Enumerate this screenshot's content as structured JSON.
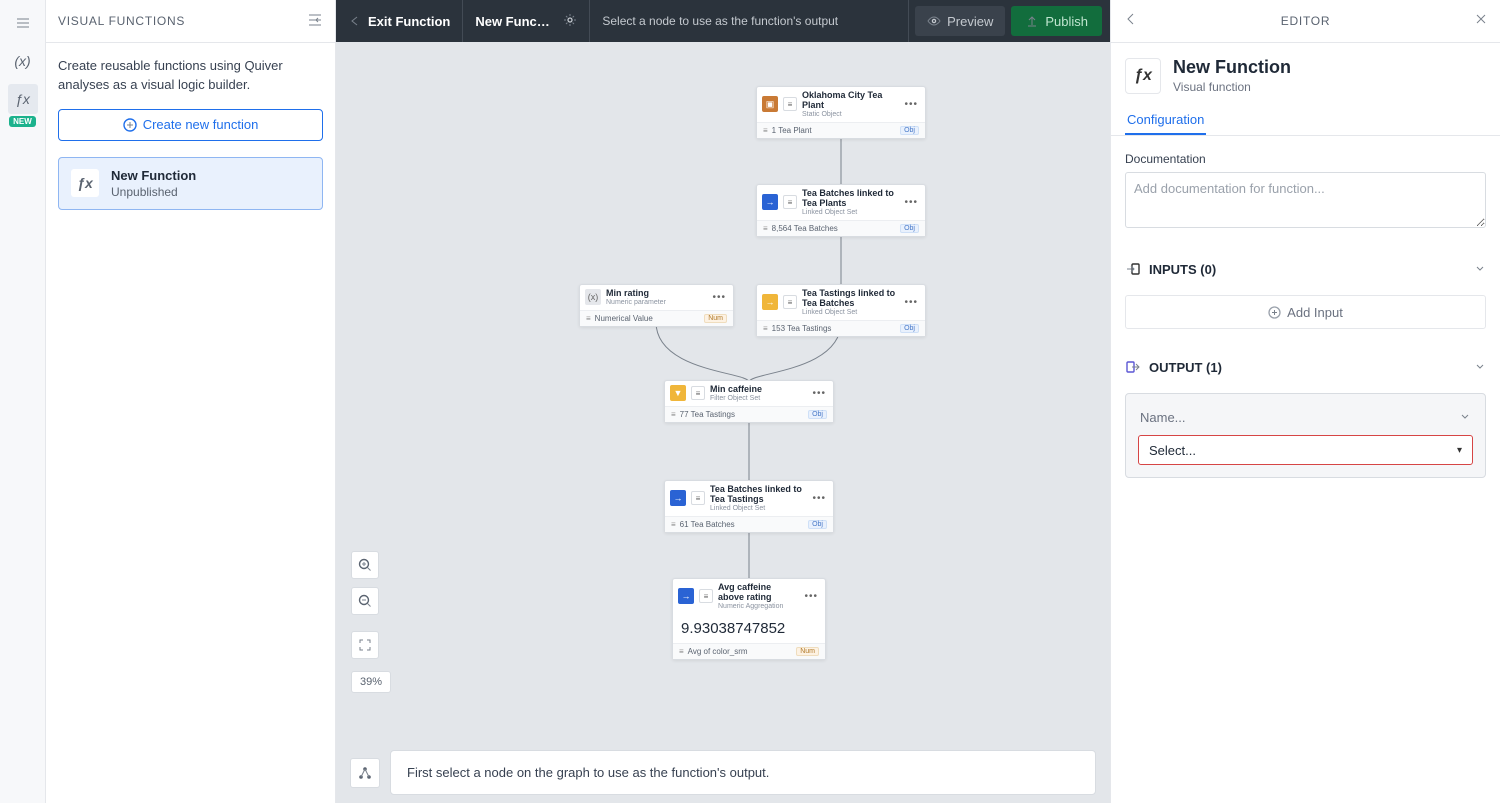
{
  "rail": {
    "new_badge": "NEW"
  },
  "sidebar": {
    "title": "VISUAL FUNCTIONS",
    "description": "Create reusable functions using Quiver analyses as a visual logic builder.",
    "create_button": "Create new function",
    "card": {
      "name": "New Function",
      "status": "Unpublished"
    }
  },
  "toolbar": {
    "exit": "Exit Function",
    "func_name": "New Functi...",
    "help_text": "Select a node to use as the function's output",
    "preview": "Preview",
    "publish": "Publish"
  },
  "canvas": {
    "zoom": "39%",
    "hint": "First select a node on the graph to use as the function's output.",
    "nodes": {
      "n1": {
        "title": "Oklahoma City Tea Plant",
        "subtitle": "Static Object",
        "foot": "1 Tea Plant",
        "tag": "Obj"
      },
      "n2": {
        "title": "Tea Batches linked to Tea Plants",
        "subtitle": "Linked Object Set",
        "foot": "8,564 Tea Batches",
        "tag": "Obj"
      },
      "n3": {
        "title": "Min rating",
        "subtitle": "Numeric parameter",
        "foot": "Numerical Value",
        "tag": "Num"
      },
      "n4": {
        "title": "Tea Tastings linked to Tea Batches",
        "subtitle": "Linked Object Set",
        "foot": "153 Tea Tastings",
        "tag": "Obj"
      },
      "n5": {
        "title": "Min caffeine",
        "subtitle": "Filter Object Set",
        "foot": "77 Tea Tastings",
        "tag": "Obj"
      },
      "n6": {
        "title": "Tea Batches linked to Tea Tastings",
        "subtitle": "Linked Object Set",
        "foot": "61 Tea Batches",
        "tag": "Obj"
      },
      "n7": {
        "title": "Avg caffeine above rating",
        "subtitle": "Numeric Aggregation",
        "value": "9.93038747852",
        "foot": "Avg of color_srm",
        "tag": "Num"
      }
    }
  },
  "editor": {
    "title": "EDITOR",
    "fn_name": "New Function",
    "fn_type": "Visual function",
    "tab_config": "Configuration",
    "doc_label": "Documentation",
    "doc_placeholder": "Add documentation for function...",
    "inputs_head": "INPUTS (0)",
    "add_input": "Add Input",
    "outputs_head": "OUTPUT (1)",
    "out_name_ph": "Name...",
    "out_select_ph": "Select..."
  }
}
